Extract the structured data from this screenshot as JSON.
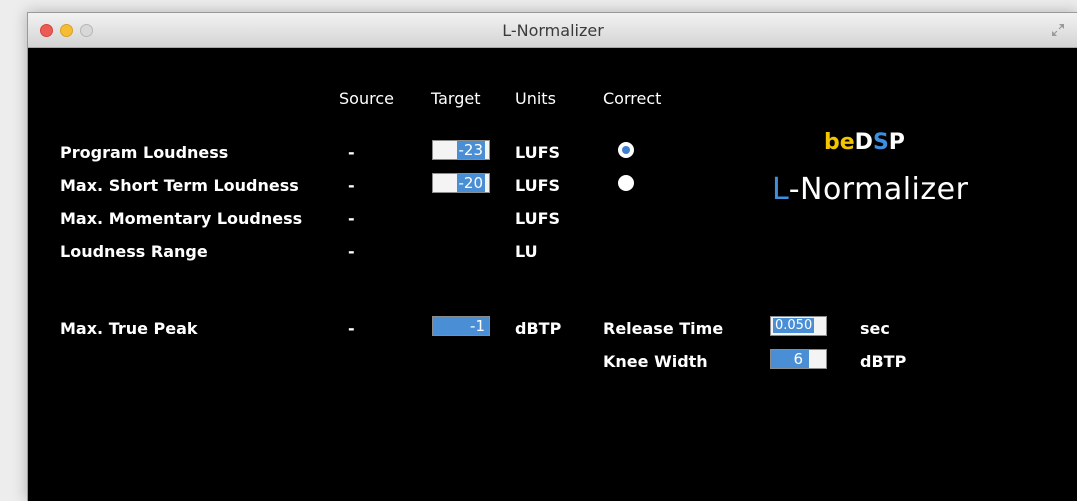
{
  "window": {
    "title": "L-Normalizer"
  },
  "headers": {
    "source": "Source",
    "target": "Target",
    "units": "Units",
    "correct": "Correct"
  },
  "rows": [
    {
      "label": "Program Loudness",
      "source": "-",
      "target": "-23",
      "unit": "LUFS"
    },
    {
      "label": "Max. Short Term Loudness",
      "source": "-",
      "target": "-20",
      "unit": "LUFS"
    },
    {
      "label": "Max. Momentary Loudness",
      "source": "-",
      "unit": "LUFS"
    },
    {
      "label": "Loudness Range",
      "source": "-",
      "unit": "LU"
    },
    {
      "label": "Max. True Peak",
      "source": "-",
      "target": "-1",
      "unit": "dBTP"
    }
  ],
  "correct": {
    "program_loudness_selected": true,
    "short_term_selected": false
  },
  "brand": {
    "be": "be",
    "dsp_d": "D",
    "dsp_s": "S",
    "dsp_p": "P",
    "product_l": "L",
    "product_rest": "-Normalizer",
    "colors": {
      "be": "#f5c400",
      "s": "#3d8fe0",
      "l": "#3d8fe0",
      "white": "#ffffff"
    }
  },
  "limiter": {
    "release_label": "Release Time",
    "release_value": "0.050",
    "release_unit": "sec",
    "knee_label": "Knee Width",
    "knee_value": "6",
    "knee_unit": "dBTP"
  },
  "colors": {
    "accent": "#4a8fd6",
    "background": "#000000"
  },
  "icons": {
    "fullscreen": "fullscreen-icon"
  }
}
